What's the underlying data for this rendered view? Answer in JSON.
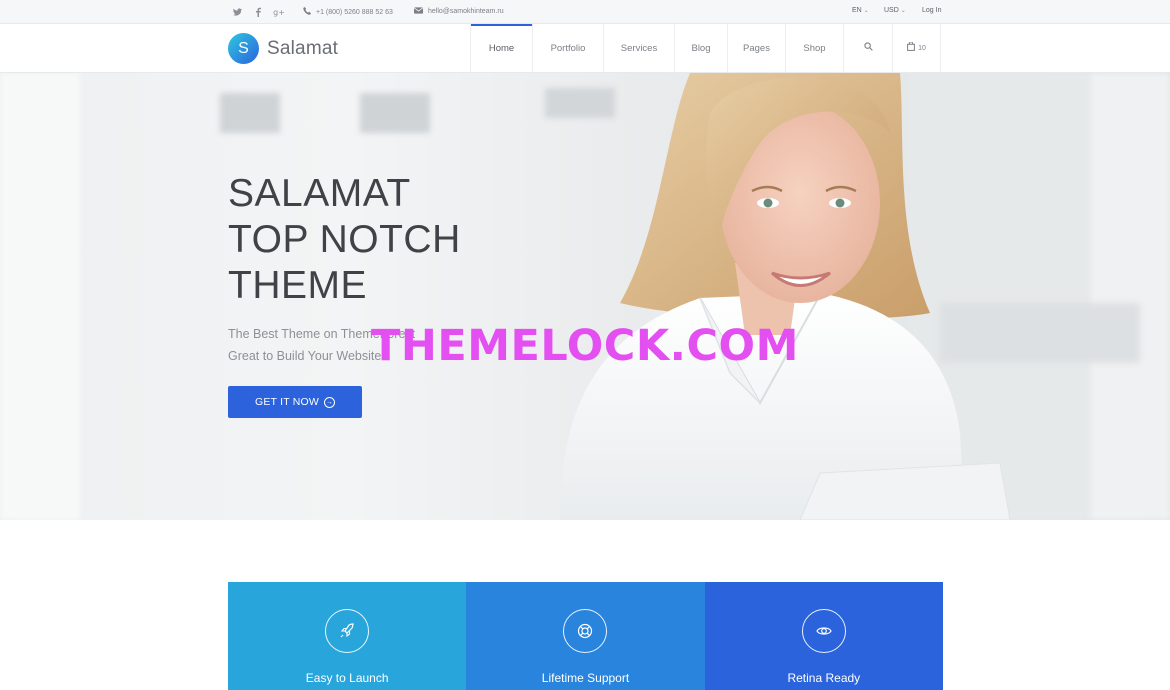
{
  "topbar": {
    "social": [
      "twitter-icon",
      "facebook-icon",
      "google-plus-icon"
    ],
    "phone": "+1 (800) 5260 888 52 63",
    "email": "hello@samokhinteam.ru",
    "language": "EN",
    "currency": "USD",
    "login": "Log In"
  },
  "header": {
    "logo_letter": "S",
    "logo_text": "Salamat",
    "nav": [
      {
        "label": "Home",
        "active": true
      },
      {
        "label": "Portfolio"
      },
      {
        "label": "Services"
      },
      {
        "label": "Blog"
      },
      {
        "label": "Pages"
      },
      {
        "label": "Shop"
      }
    ],
    "cart_count": "10"
  },
  "hero": {
    "title_line1": "SALAMAT",
    "title_line2": "TOP NOTCH",
    "title_line3": "THEME",
    "sub_line1": "The Best Theme on ThemeForest",
    "sub_line2": "Great to Build Your Website",
    "button_label": "GET IT NOW",
    "watermark": "THEMELOCK.COM"
  },
  "features": [
    {
      "label": "Easy to Launch",
      "icon": "rocket-icon",
      "color": "#28a6dc"
    },
    {
      "label": "Lifetime Support",
      "icon": "lifebuoy-icon",
      "color": "#2884dc"
    },
    {
      "label": "Retina Ready",
      "icon": "eye-icon",
      "color": "#2a63dc"
    }
  ],
  "colors": {
    "accent": "#2c63dc",
    "topbar_bg": "#f6f7f9",
    "watermark": "#e34ff0"
  }
}
